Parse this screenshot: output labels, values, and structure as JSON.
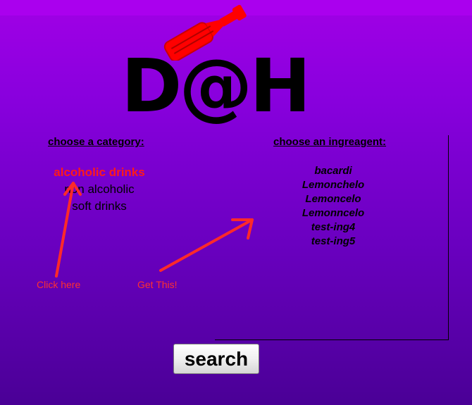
{
  "logo": {
    "text": "D@H"
  },
  "categories": {
    "heading": "choose a category:",
    "items": [
      {
        "label": "alcoholic drinks",
        "active": true
      },
      {
        "label": "non alcoholic",
        "active": false
      },
      {
        "label": "soft drinks",
        "active": false
      }
    ]
  },
  "ingredients": {
    "heading": "choose an ingreagent:",
    "items": [
      "bacardi",
      "Lemonchelo",
      "Lemoncelo",
      "Lemonncelo",
      "test-ing4",
      "test-ing5"
    ]
  },
  "annotations": {
    "click_here": "Click here",
    "get_this": "Get This!",
    "color": "#ff2a2a"
  },
  "search_button": {
    "label": "search"
  },
  "colors": {
    "background_top": "#a100e6",
    "background_bottom": "#4a0096",
    "accent": "#ff1a1a",
    "bottle": "#ff0000"
  },
  "icons": [
    "bottle-icon",
    "arrow-icon"
  ]
}
